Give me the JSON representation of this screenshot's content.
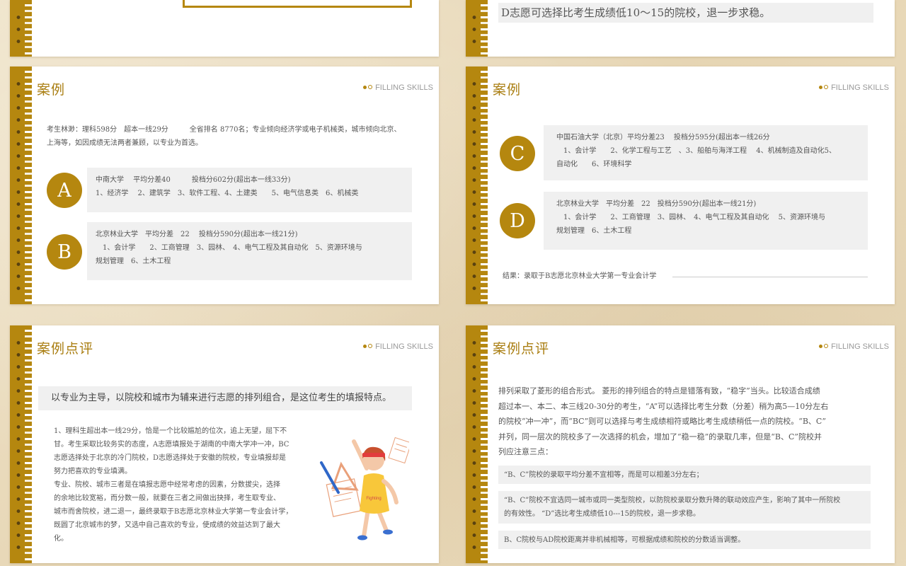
{
  "brand": "FILLING SKILLS",
  "slide_top_right": {
    "text": "D志愿可选择比考生成绩低10～15的院校，退一步求稳。"
  },
  "slide_case_1": {
    "title": "案例",
    "intro": [
      "考生林渺：理科598分　超本一线29分　　　全省排名 8770名；专业倾向经济学或电子机械类，城市倾向北京、",
      "上海等，如因成绩无法两者兼顾，以专业为首选。"
    ],
    "items": [
      {
        "letter": "A",
        "lines": [
          "中南大学　 平均分差40　　　投档分602分(超出本一线33分)",
          "1、经济学　 2、建筑学　3、软件工程、4、土建类　　5、电气信息类　6、机械类"
        ]
      },
      {
        "letter": "B",
        "lines": [
          "北京林业大学　平均分差　22　 投档分590分(超出本一线21分)",
          "　1、会计学　　2、工商管理　3、园林、　4、电气工程及其自动化　5、资源环境与",
          "规划管理　6、土木工程"
        ]
      }
    ]
  },
  "slide_case_2": {
    "title": "案例",
    "items": [
      {
        "letter": "C",
        "lines": [
          "中国石油大学（北京）平均分差23　 投档分595分(超出本一线26分",
          "　1、会计学　　2、化学工程与工艺　、3、船舶与海洋工程　 4、机械制造及自动化5、",
          "自动化　　6、环境科学"
        ]
      },
      {
        "letter": "D",
        "lines": [
          "北京林业大学　平均分差　22　投档分590分(超出本一线21分)",
          "　1、会计学　　2、工商管理　3、园林、　4、电气工程及其自动化　 5、资源环境与",
          "规划管理　6、土木工程"
        ]
      }
    ],
    "result": "结果：录取于B志愿北京林业大学第一专业会计学"
  },
  "slide_review_1": {
    "title": "案例点评",
    "banner": "以专业为主导，以院校和城市为辅来进行志愿的排列组合，是这位考生的填报特点。",
    "body": [
      "1、理科生超出本一线29分，恰是一个比较尴尬的位次，追上无望，屈下不",
      "甘。考生采取比较务实的态度，A志愿填报处于湖南的中南大学冲一冲，BC",
      "志愿选择处于北京的冷门院校，D志愿选择处于安徽的院校，专业填报却是",
      "努力把喜欢的专业填满。",
      "专业、院校、城市三者是在填报志愿中经常考虑的因素，分数拔尖，选择",
      "的余地比较宽裕，而分数一般，就要在三者之间做出抉择，考生取专业、",
      "城市而舍院校，进二退一，最终录取于B志愿北京林业大学第一专业会计学，",
      "既圆了北京城市的梦，又选中自己喜欢的专业，使成绩的效益达到了最大",
      "化。"
    ],
    "illustration_badge": "Fighting"
  },
  "slide_review_2": {
    "title": "案例点评",
    "body": [
      "排列采取了菱形的组合形式。 菱形的排列组合的特点是错落有致，“稳字”当头。比较适合成绩",
      "超过本一、本二、本三线20-30分的考生，“A”可以选择比考生分数（分差）稍为高5—10分左右",
      "的院校“冲一冲”，而“BC”则可以选择与考生成绩相符或略比考生成绩稍低一点的院校。“B、C”",
      "并列，同一层次的院校多了一次选择的机会，增加了“稳一稳”的录取几率，但是“B、C”院校并",
      "列应注意三点："
    ],
    "points": [
      [
        "“B、C”院校的录取平均分差不宜相等，而是可以相差3分左右；"
      ],
      [
        "“B、C”院校不宜选同一城市或同一类型院校，以防院校录取分数升降的联动效应产生，影响了其中一所院校",
        "的有效性。 “D”选比考生成绩低10---15的院校，退一步求稳。"
      ],
      [
        "B、C院校与AD院校距离并非机械相等，可根据成绩和院校的分数适当调整。"
      ]
    ]
  },
  "colors": {
    "accent": "#b5870f",
    "title": "#a97d10",
    "box": "#f0f0f0"
  }
}
